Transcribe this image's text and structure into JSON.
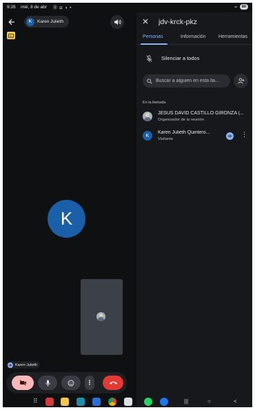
{
  "status_bar": {
    "time": "9:26",
    "date": "mié, 8 de abr",
    "left_icons": "⓪ ◘ ◑ •",
    "right_icons": "≈",
    "battery": "89"
  },
  "call": {
    "back_icon": "arrow-left-icon",
    "active_speaker_initial": "K",
    "active_speaker_name": "Karen Julieth",
    "main_avatar_initial": "K",
    "self_label_name": "Karen Julieth",
    "controls": {
      "camera": "camera-off-icon",
      "mic": "microphone-icon",
      "emoji": "emoji-icon",
      "more": "⋮",
      "end": "phone-end-icon"
    }
  },
  "panel": {
    "close_icon": "close-icon",
    "meeting_code": "jdv-krck-pkz",
    "tabs": [
      "Personas",
      "Información",
      "Herramientas"
    ],
    "active_tab": "Personas",
    "mute_all_label": "Silenciar a todos",
    "search_placeholder": "Buscar a alguien en esta lla...",
    "section_label": "En la llamada",
    "participants": [
      {
        "name": "JESUS DAVID CASTILLO GIRONZA (...",
        "role": "Organizador de la reunión",
        "avatar": "photo"
      },
      {
        "name": "Karen Julieth Quintero...",
        "role": "Visitante",
        "avatar_initial": "K",
        "more": "⋮"
      }
    ]
  },
  "nav_bar": {
    "apps_grid": "⠿",
    "recent": "|||",
    "home": "○",
    "back": "<"
  },
  "colors": {
    "background": "#0f1012",
    "panel": "#17181b",
    "accent": "#8ab4f8",
    "avatar_blue": "#1a5fa8",
    "end_call": "#e53935",
    "camera_off": "#f6b8b8"
  }
}
